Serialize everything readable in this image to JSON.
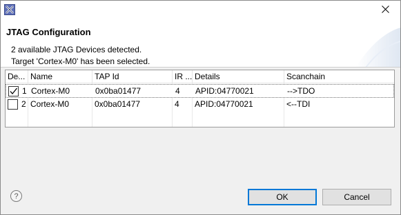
{
  "window": {
    "title": "",
    "close_icon": "close-icon",
    "app_icon": "eclipse-x-icon"
  },
  "header": {
    "title": "JTAG Configuration",
    "message_line1": "2 available JTAG Devices detected.",
    "message_line2": "Target 'Cortex-M0' has been selected."
  },
  "table": {
    "columns": [
      "De...",
      "Name",
      "TAP Id",
      "IR ...",
      "Details",
      "Scanchain"
    ],
    "rows": [
      {
        "checked": true,
        "index": "1",
        "name": "Cortex-M0",
        "tap_id": "0x0ba01477",
        "ir": "4",
        "details": "APID:04770021",
        "scanchain": "-->TDO"
      },
      {
        "checked": false,
        "index": "2",
        "name": "Cortex-M0",
        "tap_id": "0x0ba01477",
        "ir": "4",
        "details": "APID:04770021",
        "scanchain": "<--TDI"
      }
    ]
  },
  "footer": {
    "help_icon": "help-icon",
    "help_glyph": "?",
    "ok_label": "OK",
    "cancel_label": "Cancel"
  },
  "colors": {
    "accent": "#0078d7",
    "dialog_bg": "#f0f0f0",
    "header_bg": "#ffffff"
  }
}
